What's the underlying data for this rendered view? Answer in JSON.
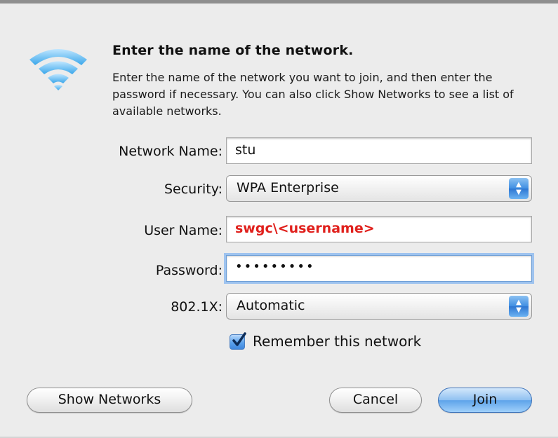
{
  "dialog": {
    "title": "Enter the name of the network.",
    "message": "Enter the name of the network you want to join, and then enter the password if necessary. You can also click Show Networks to see a list of available networks.",
    "icon": "wifi-icon"
  },
  "form": {
    "network_name": {
      "label": "Network Name:",
      "value": "stu"
    },
    "security": {
      "label": "Security:",
      "selected": "WPA Enterprise"
    },
    "user_name": {
      "label": "User Name:",
      "value": "swgc\\<username>"
    },
    "password": {
      "label": "Password:",
      "masked_value": "•••••••••"
    },
    "eap": {
      "label": "802.1X:",
      "selected": "Automatic"
    },
    "remember": {
      "label": "Remember this network",
      "checked": true
    }
  },
  "buttons": {
    "show_networks": "Show Networks",
    "cancel": "Cancel",
    "join": "Join"
  },
  "colors": {
    "accent": "#3f8ee3",
    "username_text": "#e0201c",
    "dialog_background": "#ececec"
  }
}
